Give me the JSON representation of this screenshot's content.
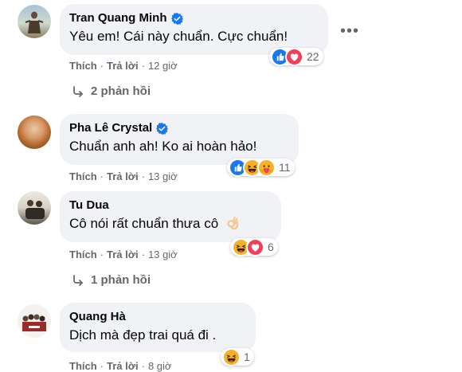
{
  "colors": {
    "bubble_bg": "#f0f2f5",
    "meta_text": "#65676b",
    "verified": "#1877f2",
    "like": "#1877f2",
    "love": "#f33e58",
    "haha": "#f7b125"
  },
  "comments": [
    {
      "author": "Tran Quang Minh",
      "verified": true,
      "text": "Yêu em! Cái này chuẩn. Cực chuẩn!",
      "like_label": "Thích",
      "reply_label": "Trả lời",
      "time": "12 giờ",
      "reaction_icons": [
        "like-icon",
        "love-icon"
      ],
      "reaction_count": "22",
      "replies_label": "2 phản hồi",
      "more_label": "•••"
    },
    {
      "author": "Pha Lê Crystal",
      "verified": true,
      "text": "Chuẩn anh ah! Ko ai hoàn hảo!",
      "like_label": "Thích",
      "reply_label": "Trả lời",
      "time": "13 giờ",
      "reaction_icons": [
        "like-icon",
        "haha-icon",
        "care-icon"
      ],
      "reaction_count": "11"
    },
    {
      "author": "Tu Dua",
      "verified": false,
      "text": "Cô nói rất chuẩn thưa cô",
      "text_emoji": "ok-hand-icon",
      "like_label": "Thích",
      "reply_label": "Trả lời",
      "time": "13 giờ",
      "reaction_icons": [
        "haha-icon",
        "love-icon"
      ],
      "reaction_count": "6",
      "replies_label": "1 phản hồi"
    },
    {
      "author": "Quang Hà",
      "verified": false,
      "text": "Dịch mà đẹp trai quá đi .",
      "like_label": "Thích",
      "reply_label": "Trả lời",
      "time": "8 giờ",
      "reaction_icons": [
        "haha-icon"
      ],
      "reaction_count": "1"
    }
  ]
}
